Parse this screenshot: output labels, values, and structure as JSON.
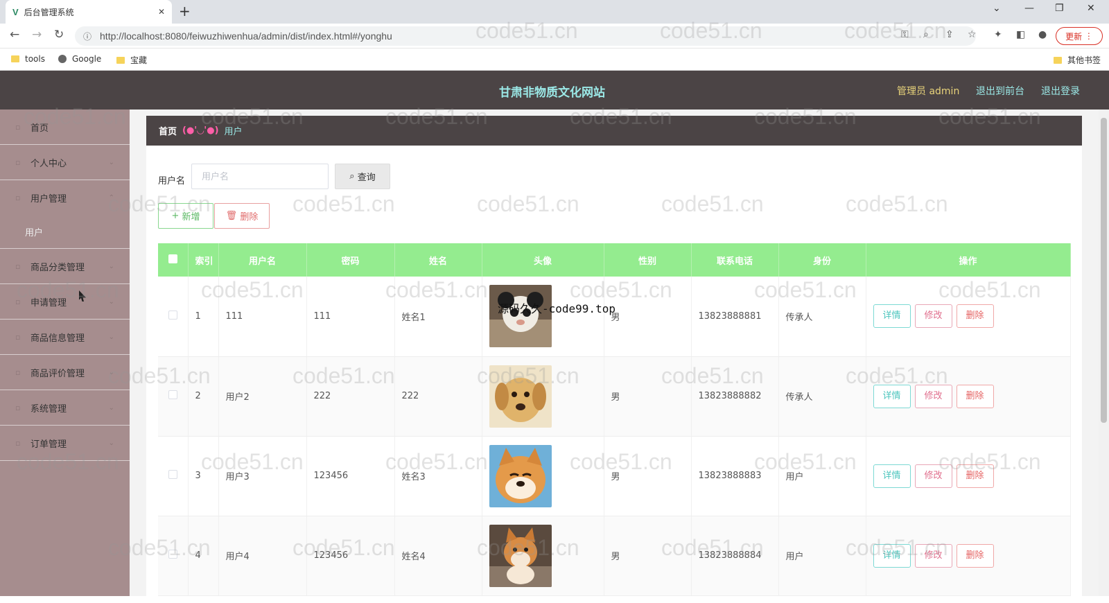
{
  "browser": {
    "tab_title": "后台管理系统",
    "tab_favicon": "V",
    "url": "http://localhost:8080/feiwuzhiwenhua/admin/dist/index.html#/yonghu",
    "update_label": "更新",
    "bookmarks": [
      {
        "label": "tools",
        "icon": "folder-icon"
      },
      {
        "label": "Google",
        "icon": "globe-icon"
      },
      {
        "label": "宝藏",
        "icon": "folder-icon"
      }
    ],
    "other_bookmarks": "其他书签"
  },
  "header": {
    "site_title": "甘肃非物质文化网站",
    "admin_label": "管理员 admin",
    "links": [
      "退出到前台",
      "退出登录"
    ],
    "bg_color": "#4b4445",
    "accent_color": "#9be9e7"
  },
  "sidebar": {
    "items": [
      {
        "label": "首页"
      },
      {
        "label": "个人中心"
      },
      {
        "label": "用户管理"
      },
      {
        "label": "商品分类管理"
      },
      {
        "label": "申请管理"
      },
      {
        "label": "商品信息管理"
      },
      {
        "label": "商品评价管理"
      },
      {
        "label": "系统管理"
      },
      {
        "label": "订单管理"
      }
    ],
    "sub_item": "用户",
    "bg_color": "#a68d8e"
  },
  "breadcrumb": {
    "home": "首页",
    "separator": "(●'◡'●)",
    "current": "用户"
  },
  "search": {
    "label": "用户名",
    "placeholder": "用户名",
    "query_button": "查询"
  },
  "actions": {
    "add": "新增",
    "delete": "删除"
  },
  "table": {
    "header_color": "#94ec8f",
    "columns": [
      "索引",
      "用户名",
      "密码",
      "姓名",
      "头像",
      "性别",
      "联系电话",
      "身份",
      "操作"
    ],
    "rows": [
      {
        "index": "1",
        "username": "111",
        "password": "111",
        "name": "姓名1",
        "avatar": "avatar-cat",
        "gender": "男",
        "phone": "13823888881",
        "role": "传承人"
      },
      {
        "index": "2",
        "username": "用户2",
        "password": "222",
        "name": "222",
        "avatar": "avatar-puppy",
        "gender": "男",
        "phone": "13823888882",
        "role": "传承人"
      },
      {
        "index": "3",
        "username": "用户3",
        "password": "123456",
        "name": "姓名3",
        "avatar": "avatar-shiba",
        "gender": "男",
        "phone": "13823888883",
        "role": "用户"
      },
      {
        "index": "4",
        "username": "用户4",
        "password": "123456",
        "name": "姓名4",
        "avatar": "avatar-shiba-2",
        "gender": "男",
        "phone": "13823888884",
        "role": "用户"
      }
    ],
    "ops": [
      "详情",
      "修改",
      "删除"
    ]
  },
  "watermarks": {
    "main": "code51.cn",
    "overlay": "源码久久-code99.top"
  }
}
